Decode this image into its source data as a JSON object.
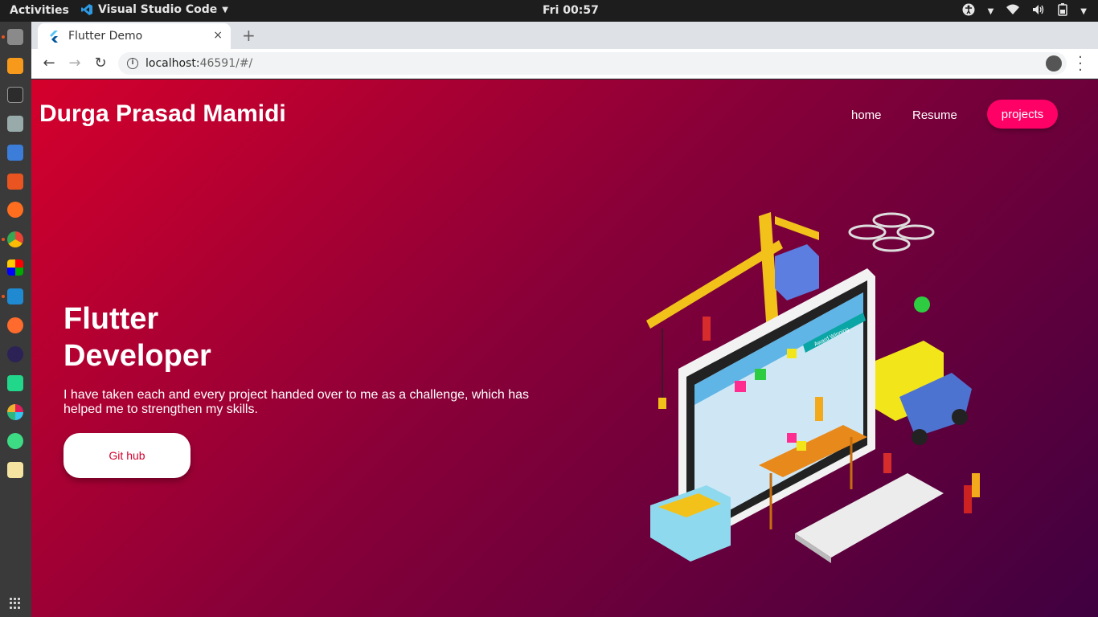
{
  "topbar": {
    "activities": "Activities",
    "app_name": "Visual Studio Code",
    "clock": "Fri 00:57"
  },
  "browser": {
    "tab_title": "Flutter Demo",
    "url_host": "localhost:",
    "url_port": "46591/#/",
    "new_tab": "+",
    "close": "×"
  },
  "site": {
    "brand": "Durga Prasad Mamidi",
    "nav": {
      "home": "home",
      "resume": "Resume",
      "projects": "projects"
    },
    "hero": {
      "title_line1": "Flutter",
      "title_line2": "Developer",
      "text": "I have taken each and every project handed over to me as a challenge, which has helped me to strengthen my skills.",
      "button": "Git hub"
    },
    "illustration_banner": "Award Winning"
  },
  "colors": {
    "gradient_start": "#d5002c",
    "gradient_end": "#3f0040",
    "accent": "#ff0066"
  }
}
